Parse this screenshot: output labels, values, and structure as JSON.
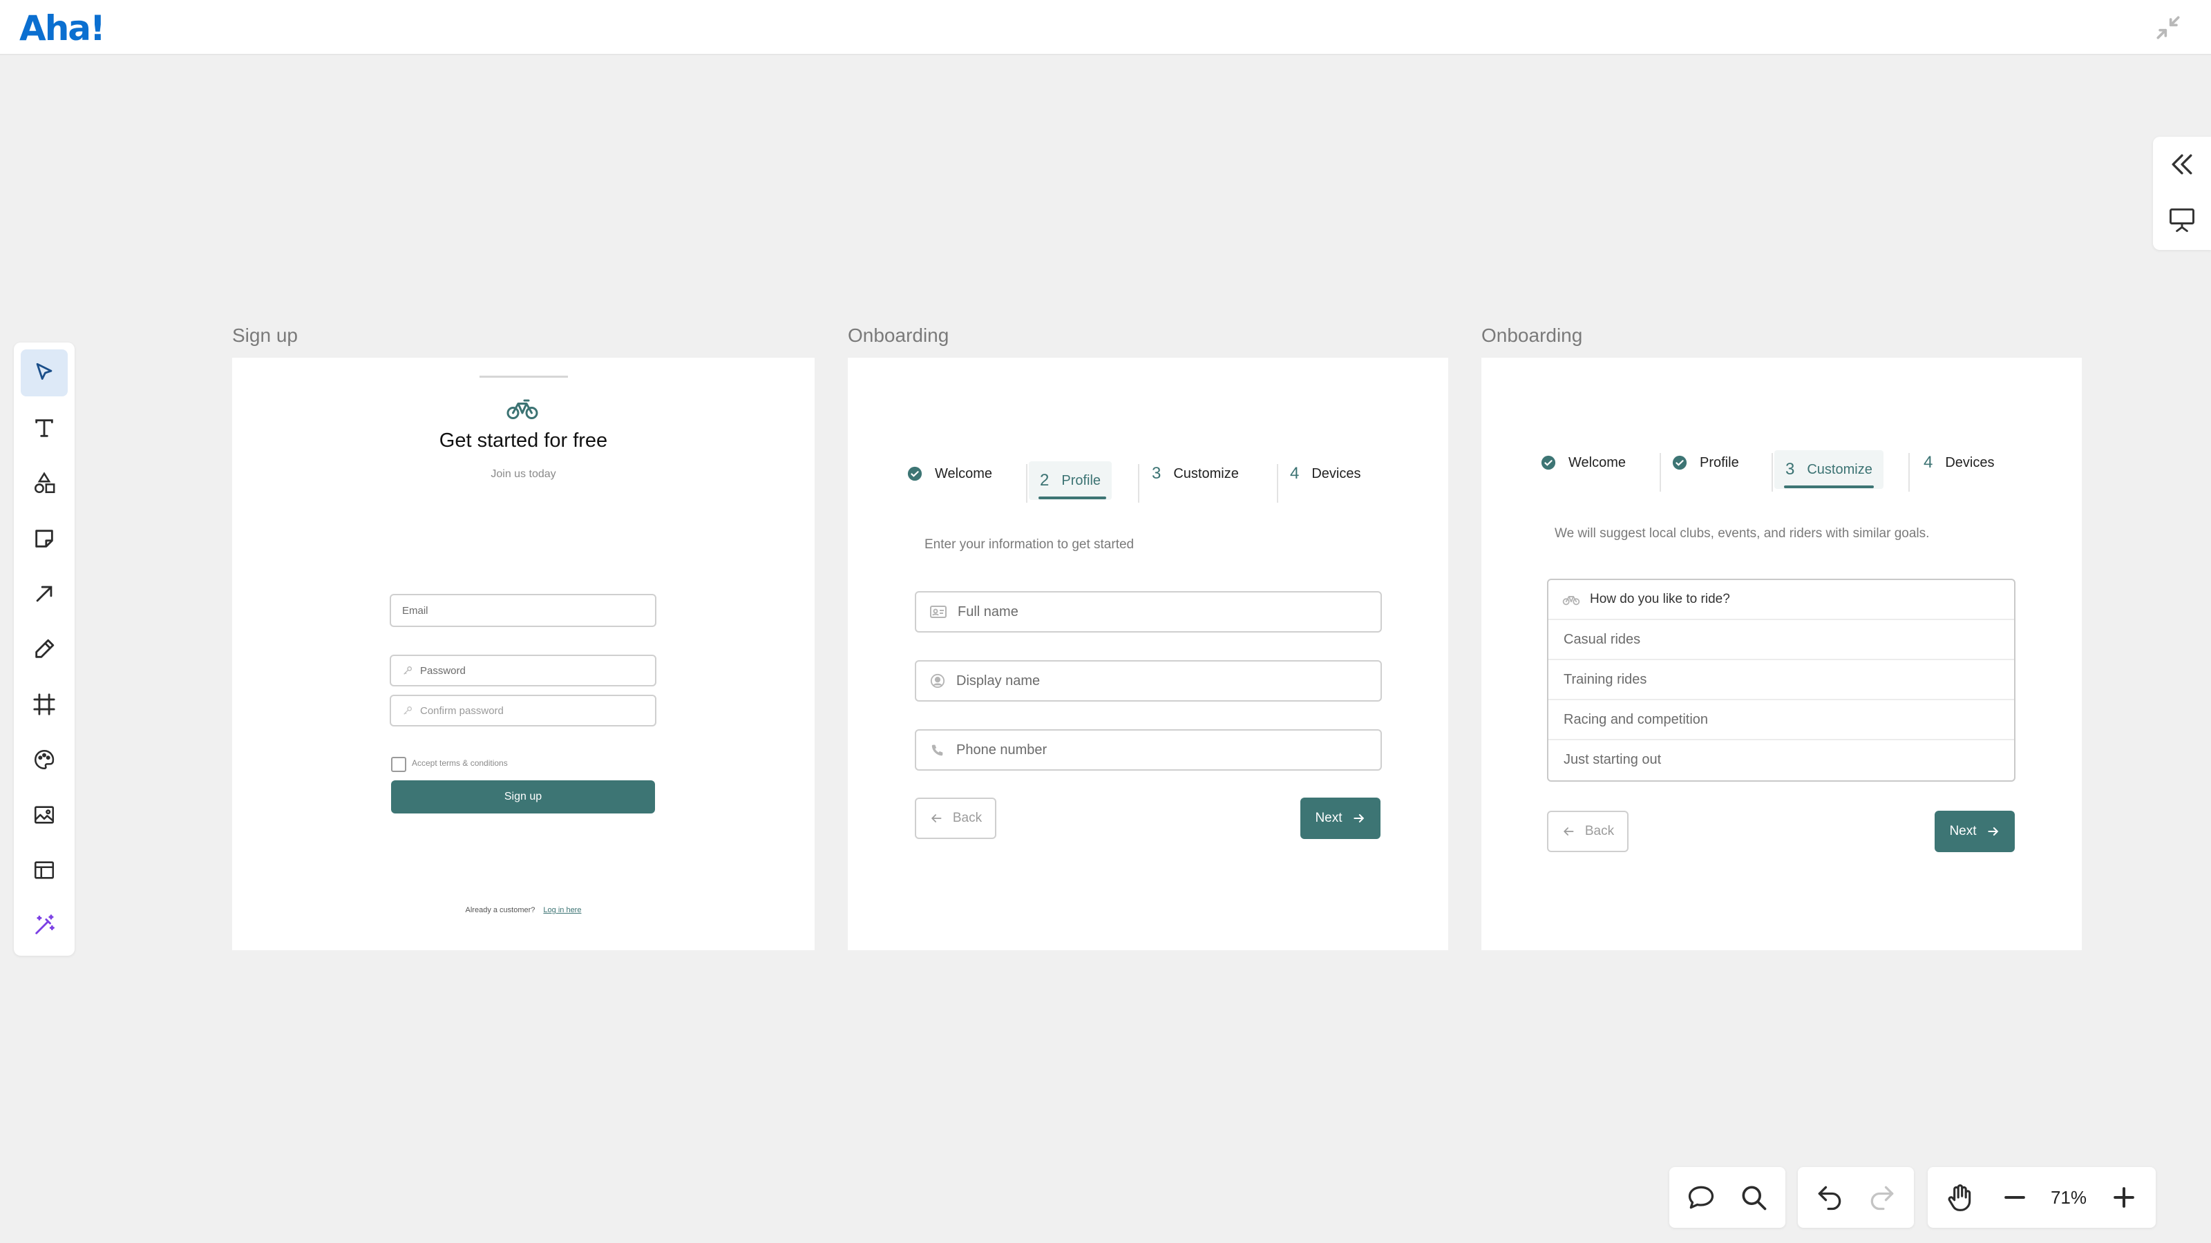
{
  "app": {
    "logo": "Aha!"
  },
  "frames": {
    "signup": {
      "label": "Sign up",
      "title": "Get started for free",
      "subtitle": "Join us today",
      "email_placeholder": "Email",
      "password_placeholder": "Password",
      "confirm_placeholder": "Confirm password",
      "terms_label": "Accept terms & conditions",
      "button_label": "Sign up",
      "footer_text": "Already a customer?",
      "footer_link": "Log in here"
    },
    "profile": {
      "label": "Onboarding",
      "steps": [
        {
          "num": "",
          "label": "Welcome",
          "state": "done"
        },
        {
          "num": "2",
          "label": "Profile",
          "state": "active"
        },
        {
          "num": "3",
          "label": "Customize",
          "state": "todo"
        },
        {
          "num": "4",
          "label": "Devices",
          "state": "todo"
        }
      ],
      "intro": "Enter your information to get started",
      "fields": [
        "Full name",
        "Display name",
        "Phone number"
      ],
      "back_label": "Back",
      "next_label": "Next"
    },
    "customize": {
      "label": "Onboarding",
      "steps": [
        {
          "num": "",
          "label": "Welcome",
          "state": "done"
        },
        {
          "num": "",
          "label": "Profile",
          "state": "done"
        },
        {
          "num": "3",
          "label": "Customize",
          "state": "active"
        },
        {
          "num": "4",
          "label": "Devices",
          "state": "todo"
        }
      ],
      "intro": "We will suggest local clubs, events, and riders with similar goals.",
      "question": "How do you like to ride?",
      "options": [
        "Casual rides",
        "Training rides",
        "Racing and competition",
        "Just starting out"
      ],
      "back_label": "Back",
      "next_label": "Next"
    }
  },
  "toolbar": {
    "tools": [
      "select-tool",
      "text-tool",
      "shapes-tool",
      "sticky-note-tool",
      "arrow-tool",
      "pen-tool",
      "frame-tool",
      "palette-tool",
      "image-tool",
      "template-tool",
      "ai-magic-tool"
    ]
  },
  "bottom": {
    "zoom": "71%"
  },
  "colors": {
    "brand": "#0b6fd0",
    "accent": "#3d7574",
    "active_tool_bg": "#dde9f7",
    "magic": "#7b3fe4"
  }
}
